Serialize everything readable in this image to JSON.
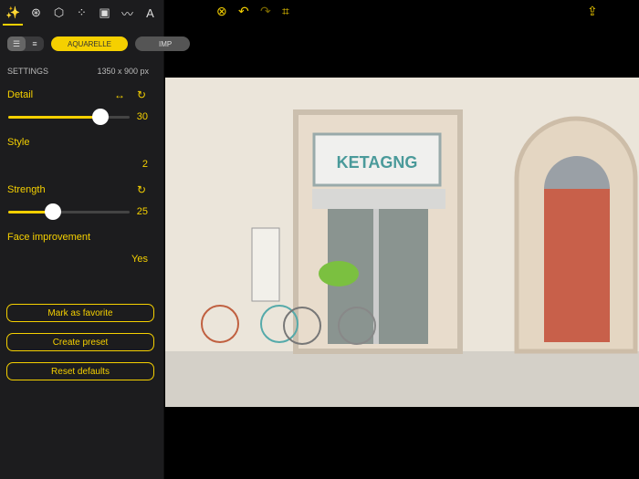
{
  "tabs": [
    {
      "icon": "magic-wand-icon",
      "glyph": "✨"
    },
    {
      "icon": "color-circles-icon",
      "glyph": "⊛"
    },
    {
      "icon": "cubes-icon",
      "glyph": "⬡"
    },
    {
      "icon": "dots-grid-icon",
      "glyph": "⁘"
    },
    {
      "icon": "image-icon",
      "glyph": "▣"
    },
    {
      "icon": "mustache-icon",
      "glyph": "〰"
    },
    {
      "icon": "text-icon",
      "glyph": "A"
    }
  ],
  "view_toggle": {
    "sliders_glyph": "☰",
    "list_glyph": "≡"
  },
  "styles": [
    "AQUARELLE",
    "IMP"
  ],
  "settings": {
    "title": "SETTINGS",
    "size": "1350 x 900 px"
  },
  "detail": {
    "label": "Detail",
    "value": "30",
    "fill_fraction": 0.76
  },
  "style": {
    "label": "Style",
    "value": "2"
  },
  "strength": {
    "label": "Strength",
    "value": "25",
    "fill_fraction": 0.37
  },
  "face": {
    "label": "Face improvement",
    "value": "Yes"
  },
  "buttons": {
    "favorite": "Mark as favorite",
    "preset": "Create preset",
    "reset": "Reset defaults"
  },
  "toolbar": {
    "close": "⊗",
    "undo": "↶",
    "redo": "↷",
    "crop": "⌗",
    "share": "⇪"
  },
  "accent": "#f5d000",
  "photo": {
    "sign": "KETAGNG"
  }
}
